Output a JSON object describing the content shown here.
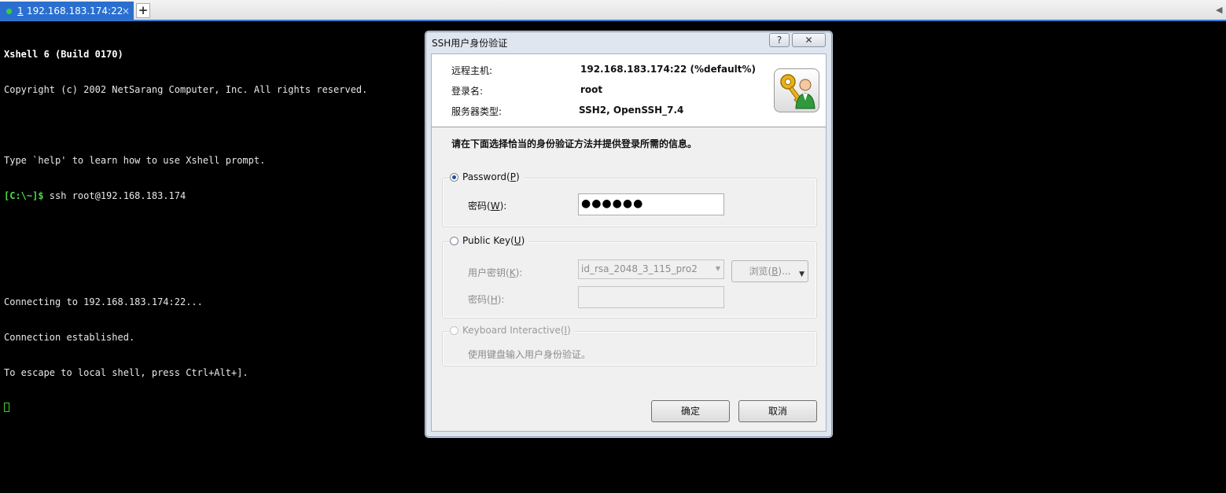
{
  "tabbar": {
    "active_tab": {
      "number": "1",
      "title": "192.168.183.174:22",
      "close": "×"
    },
    "add_label": "+",
    "scroll_left": "◀"
  },
  "terminal": {
    "lines": [
      {
        "text": "Xshell 6 (Build 0170)",
        "style": "bold"
      },
      {
        "text": "Copyright (c) 2002 NetSarang Computer, Inc. All rights reserved.",
        "style": "normal"
      },
      {
        "text": "",
        "style": "normal"
      },
      {
        "text": "Type `help' to learn how to use Xshell prompt.",
        "style": "normal"
      },
      {
        "prompt": "[C:\\~]$",
        "text": " ssh root@192.168.183.174",
        "style": "prompt"
      },
      {
        "text": "",
        "style": "normal"
      },
      {
        "text": "",
        "style": "normal"
      },
      {
        "text": "Connecting to 192.168.183.174:22...",
        "style": "normal"
      },
      {
        "text": "Connection established.",
        "style": "normal"
      },
      {
        "text": "To escape to local shell, press Ctrl+Alt+].",
        "style": "normal"
      }
    ]
  },
  "dialog": {
    "title": "SSH用户身份验证",
    "help_label": "?",
    "close_label": "✕",
    "remote_host_label": "远程主机:",
    "remote_host_value": "192.168.183.174:22 (%default%)",
    "login_label": "登录名:",
    "login_value": "root",
    "server_type_label": "服务器类型:",
    "server_type_value": "SSH2, OpenSSH_7.4",
    "instruction": "请在下面选择恰当的身份验证方法并提供登录所需的信息。",
    "password_group": {
      "legend_text": "Password(",
      "legend_key": "P",
      "legend_end": ")",
      "field_label_text": "密码(",
      "field_label_key": "W",
      "field_label_end": "):",
      "value": "●●●●●●"
    },
    "pubkey_group": {
      "legend_text": "Public Key(",
      "legend_key": "U",
      "legend_end": ")",
      "key_label_text": "用户密钥(",
      "key_label_key": "K",
      "key_label_end": "):",
      "key_selected": "id_rsa_2048_3_115_pro2",
      "browse_text": "浏览(",
      "browse_key": "B",
      "browse_end": ")...",
      "passphrase_label_text": "密码(",
      "passphrase_label_key": "H",
      "passphrase_label_end": "):"
    },
    "keyboard_group": {
      "legend_text": "Keyboard Interactive(",
      "legend_key": "I",
      "legend_end": ")",
      "description": "使用键盘输入用户身份验证。"
    },
    "ok_label": "确定",
    "cancel_label": "取消"
  }
}
